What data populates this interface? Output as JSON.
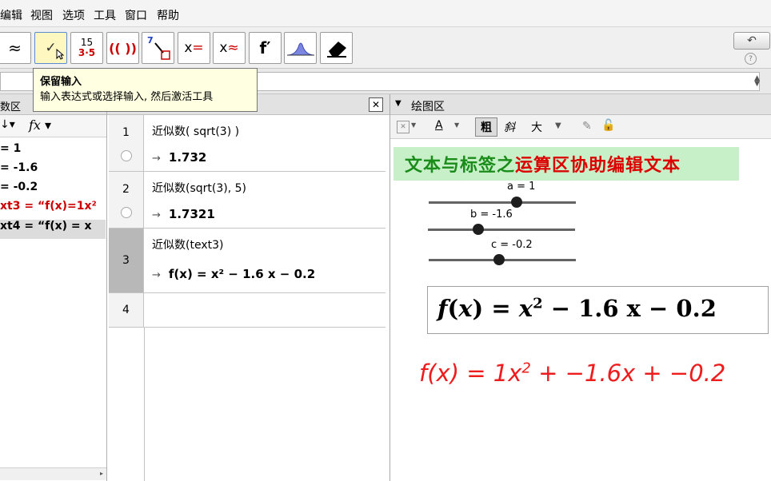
{
  "menubar": {
    "items": [
      "编辑",
      "视图",
      "选项",
      "工具",
      "窗口",
      "帮助"
    ]
  },
  "toolbar": {
    "tools": [
      {
        "name": "numeric-tool",
        "label": "≈"
      },
      {
        "name": "keep-input-tool",
        "label": "✓"
      },
      {
        "name": "factor-tool",
        "label_top": "15",
        "label_bottom": "3·5"
      },
      {
        "name": "expand-tool",
        "label": "(( ))"
      },
      {
        "name": "substitute-tool",
        "label": "7"
      },
      {
        "name": "solve-tool",
        "label": "x="
      },
      {
        "name": "nsolve-tool",
        "label": "x≈"
      },
      {
        "name": "derivative-tool",
        "label": "f′"
      },
      {
        "name": "probability-tool",
        "label": ""
      },
      {
        "name": "delete-tool",
        "label": ""
      }
    ]
  },
  "tooltip": {
    "title": "保留输入",
    "text": "输入表达式或选择输入, 然后激活工具"
  },
  "algebra": {
    "title": "数区",
    "sort_icon": "↓",
    "fx": "fx",
    "items": [
      {
        "text": "= 1",
        "color": "#000000"
      },
      {
        "text": "= -1.6",
        "color": "#000000"
      },
      {
        "text": "= -0.2",
        "color": "#000000"
      },
      {
        "text": "xt3 = “f(x)=1x²",
        "color": "#cc0000"
      },
      {
        "text": "xt4 = “f(x) = x",
        "color": "#000000"
      }
    ]
  },
  "cas": {
    "close": "✕",
    "rows": [
      {
        "num": "1",
        "input": "近似数( sqrt(3) )",
        "output": "1.732"
      },
      {
        "num": "2",
        "input": "近似数(sqrt(3), 5)",
        "output": "1.7321"
      },
      {
        "num": "3",
        "input": "近似数(text3)",
        "output": "f(x) = x² − 1.6 x − 0.2"
      },
      {
        "num": "4",
        "input": "",
        "output": ""
      }
    ]
  },
  "graphics": {
    "title": "绘图区",
    "style_bar": {
      "bold": "粗",
      "italic": "斜",
      "size": "大",
      "text_color_label": "A"
    },
    "banner": {
      "part1": "文本与标签之",
      "part2": "运算区协助编辑文本",
      "color1": "#1a8c1a",
      "color2": "#dd0000",
      "bg": "#c8f0c8"
    },
    "sliders": [
      {
        "label": "a = 1",
        "value": 1,
        "min": -5,
        "max": 5
      },
      {
        "label": "b = -1.6",
        "value": -1.6,
        "min": -5,
        "max": 5
      },
      {
        "label": "c = -0.2",
        "value": -0.2,
        "min": -5,
        "max": 5
      }
    ],
    "latex_box": {
      "f": "f",
      "x": "x",
      "eq": "=",
      "base": "x",
      "exp": "2",
      "rest": "− 1.6 x − 0.2"
    },
    "red_text": {
      "f": "f",
      "x": "x",
      "eq": "=",
      "coef": "1x",
      "exp": "2",
      "rest": "+ −1.6x + −0.2",
      "color": "#ee1c1c"
    }
  }
}
